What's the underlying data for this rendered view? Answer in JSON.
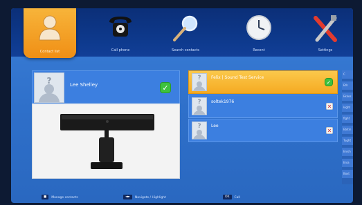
{
  "nav": {
    "items": [
      {
        "label": "Contact list",
        "icon": "contacts-icon",
        "active": true
      },
      {
        "label": "Call phone",
        "icon": "telephone-icon",
        "active": false
      },
      {
        "label": "Search contacts",
        "icon": "search-icon",
        "active": false
      },
      {
        "label": "Recent",
        "icon": "clock-icon",
        "active": false
      },
      {
        "label": "Settings",
        "icon": "settings-tools-icon",
        "active": false
      }
    ]
  },
  "selected": {
    "name": "Lee Shelley",
    "device_icon": "camera-device-icon"
  },
  "contacts": [
    {
      "name": "Felix | Sound Test Service",
      "selected": true,
      "status": "check"
    },
    {
      "name": "soltek1976",
      "selected": false,
      "status": "remove"
    },
    {
      "name": "Lee",
      "selected": false,
      "status": "remove"
    }
  ],
  "side_list": [
    "C",
    "Eth",
    "Ekkos",
    "kight",
    "fight",
    "Ebitin",
    "Tught",
    "Enish",
    "Enia",
    "Boxt"
  ],
  "footer": {
    "hints": [
      {
        "key": "■",
        "text": "Manage contacts"
      },
      {
        "key": "◄►",
        "text": "Navigate / Highlight"
      },
      {
        "key": "OK",
        "text": "Call"
      }
    ]
  },
  "colors": {
    "accent_orange": "#f5aa22",
    "panel_blue": "#3c7fe0",
    "nav_dark": "#0b2f78",
    "check_green": "#3ec23f"
  }
}
